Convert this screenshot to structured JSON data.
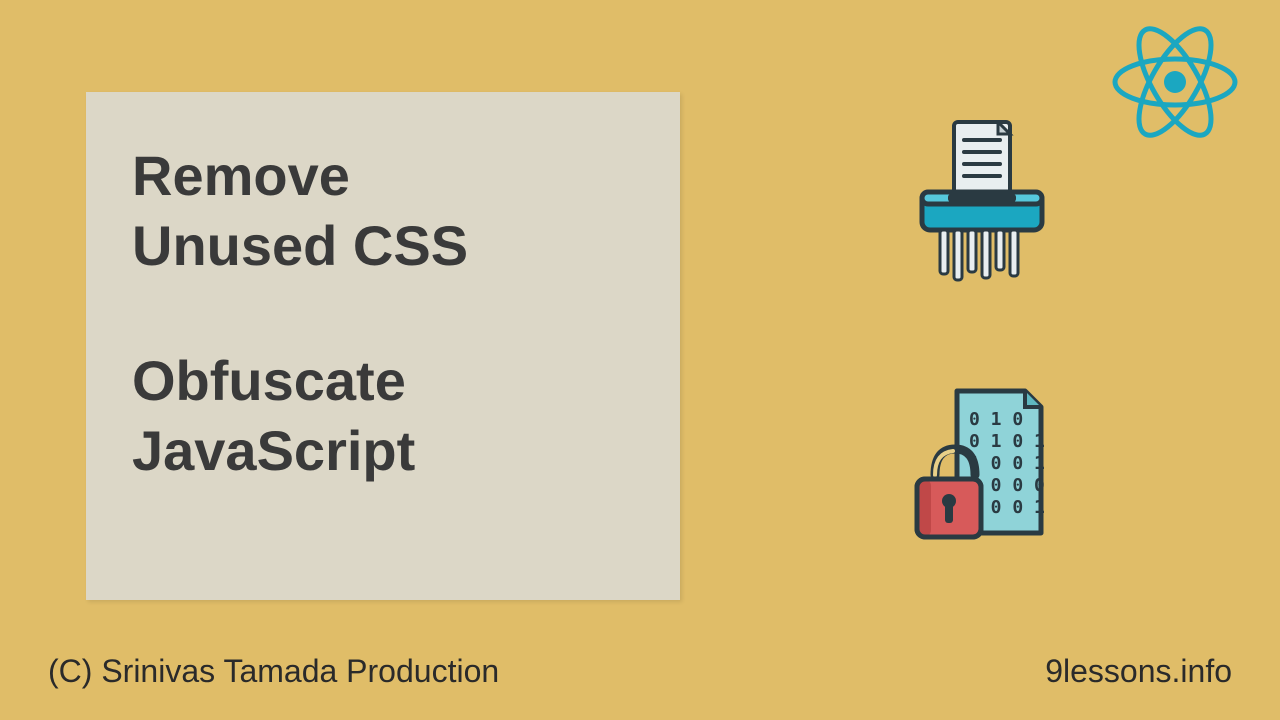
{
  "content": {
    "line1": "Remove",
    "line2": "Unused CSS",
    "line3": "Obfuscate",
    "line4": "JavaScript"
  },
  "footer": {
    "left": "(C) Srinivas Tamada Production",
    "right": "9lessons.info"
  },
  "icons": {
    "react": "react-logo",
    "shredder": "document-shredder",
    "lockfile": "encrypted-file-lock"
  },
  "colors": {
    "background": "#e0bd68",
    "box": "#dcd7c7",
    "text": "#3a3a3a",
    "accent": "#1ba7c1"
  }
}
